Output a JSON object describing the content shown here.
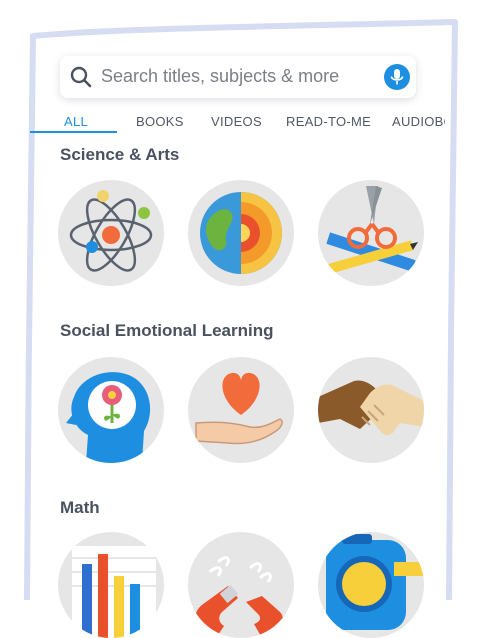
{
  "search": {
    "placeholder": "Search titles, subjects & more",
    "search_icon": "search-icon",
    "mic_icon": "microphone-icon"
  },
  "tabs": [
    {
      "label": "ALL",
      "active": true
    },
    {
      "label": "BOOKS",
      "active": false
    },
    {
      "label": "VIDEOS",
      "active": false
    },
    {
      "label": "READ-TO-ME",
      "active": false
    },
    {
      "label": "AUDIOBO",
      "active": false
    }
  ],
  "sections": [
    {
      "title": "Science & Arts",
      "items": [
        {
          "icon": "atom-icon"
        },
        {
          "icon": "earth-layers-icon"
        },
        {
          "icon": "scissors-pencil-ruler-icon"
        }
      ]
    },
    {
      "title": "Social Emotional Learning",
      "items": [
        {
          "icon": "head-flower-icon"
        },
        {
          "icon": "heart-hand-icon"
        },
        {
          "icon": "handshake-icon"
        }
      ]
    },
    {
      "title": "Math",
      "items": [
        {
          "icon": "bar-chart-icon"
        },
        {
          "icon": "magnet-icon"
        },
        {
          "icon": "tape-measure-icon"
        }
      ]
    }
  ],
  "colors": {
    "accent": "#1e8fe0",
    "text": "#4a5260",
    "tile_bg": "#e6e6e6",
    "frame": "#d6dcf2"
  }
}
